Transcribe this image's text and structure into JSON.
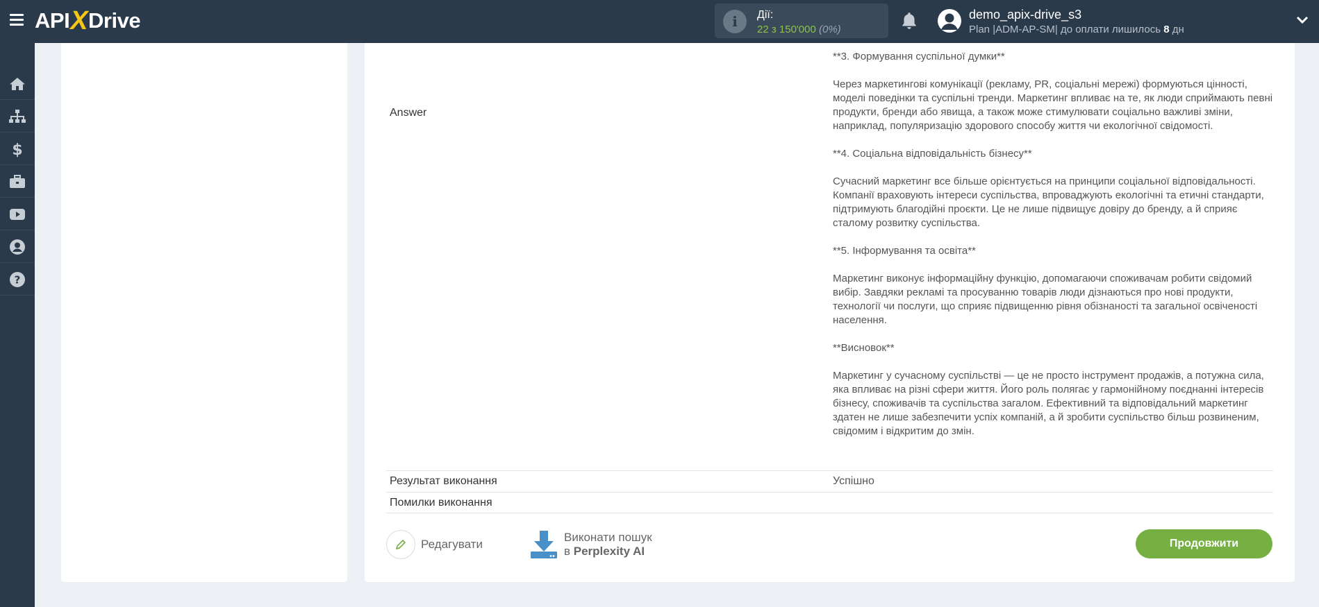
{
  "header": {
    "brand_left": "API",
    "brand_x": "X",
    "brand_right": "Drive",
    "actions_label": "Дії:",
    "actions_value": "22 з 150'000",
    "actions_percent": "(0%)",
    "username": "demo_apix-drive_s3",
    "plan_text": "Plan |ADM-AP-SM| до оплати лишилось ",
    "plan_days": "8",
    "plan_suffix": " дн"
  },
  "sidebar": {
    "items": [
      {
        "icon": "home-icon"
      },
      {
        "icon": "sitemap-icon"
      },
      {
        "icon": "dollar-icon"
      },
      {
        "icon": "briefcase-icon"
      },
      {
        "icon": "youtube-icon"
      },
      {
        "icon": "user-icon"
      },
      {
        "icon": "help-icon"
      }
    ]
  },
  "main": {
    "field_label": "Answer",
    "answer_paragraphs": [
      "**3. Формування суспільної думки**",
      "Через маркетингові комунікації (рекламу, PR, соціальні мережі) формуються цінності, моделі поведінки та суспільні тренди. Маркетинг впливає на те, як люди сприймають певні продукти, бренди або явища, а також може стимулювати соціально важливі зміни, наприклад, популяризацію здорового способу життя чи екологічної свідомості.",
      "**4. Соціальна відповідальність бізнесу**",
      "Сучасний маркетинг все більше орієнтується на принципи соціальної відповідальності. Компанії враховують інтереси суспільства, впроваджують екологічні та етичні стандарти, підтримують благодійні проєкти. Це не лише підвищує довіру до бренду, а й сприяє сталому розвитку суспільства.",
      "**5. Інформування та освіта**",
      "Маркетинг виконує інформаційну функцію, допомагаючи споживачам робити свідомий вибір. Завдяки рекламі та просуванню товарів люди дізнаються про нові продукти, технології чи послуги, що сприяє підвищенню рівня обізнаності та загальної освіченості населення.",
      "**Висновок**",
      "Маркетинг у сучасному суспільстві — це не просто інструмент продажів, а потужна сила, яка впливає на різні сфери життя. Його роль полягає у гармонійному поєднанні інтересів бізнесу, споживачів та суспільства загалом. Ефективний та відповідальний маркетинг здатен не лише забезпечити успіх компаній, а й зробити суспільство більш розвиненим, свідомим і відкритим до змін."
    ],
    "result_label": "Результат виконання",
    "result_value": "Успішно",
    "errors_label": "Помилки виконання",
    "errors_value": "",
    "edit_label": "Редагувати",
    "search_line1": "Виконати пошук",
    "search_prefix": "в ",
    "search_brand": "Perplexity AI",
    "continue_label": "Продовжити"
  },
  "colors": {
    "topbar": "#2b3a4a",
    "accent_green": "#76b043",
    "value_green": "#8bc34a",
    "logo_yellow": "#f5c518"
  }
}
